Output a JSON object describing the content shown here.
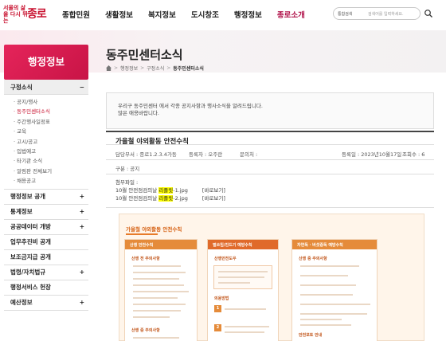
{
  "header": {
    "logo_small": "서울의 삶을 다시 뛰는",
    "logo_big": "종로",
    "nav": [
      "종합민원",
      "생활정보",
      "복지정보",
      "도시창조",
      "행정정보",
      "종로소개"
    ],
    "nav_active_index": 5,
    "search": {
      "scope": "통합검색",
      "placeholder": "검색어를 입력하세요."
    }
  },
  "banner": {
    "title": "동주민센터소식",
    "breadcrumb": [
      "행정정보",
      "구정소식",
      "동주민센터소식"
    ]
  },
  "sidebar": {
    "title": "행정정보",
    "open_group": {
      "label": "구정소식",
      "toggle": "−"
    },
    "sub_items": [
      {
        "label": "· 공지/행사",
        "active": false
      },
      {
        "label": "· 동주민센터소식",
        "active": true
      },
      {
        "label": "· 주간행사일정표",
        "active": false
      },
      {
        "label": "· 교육",
        "active": false
      },
      {
        "label": "· 고시/공고",
        "active": false
      },
      {
        "label": "· 입법예고",
        "active": false
      },
      {
        "label": "· 타기관 소식",
        "active": false
      },
      {
        "label": "· 알림판 전체보기",
        "active": false
      },
      {
        "label": "· 채용공고",
        "active": false
      }
    ],
    "groups": [
      {
        "label": "행정정보 공개",
        "toggle": "+"
      },
      {
        "label": "통계정보",
        "toggle": "+"
      },
      {
        "label": "공공데이터 개방",
        "toggle": "+"
      },
      {
        "label": "업무추진비 공개",
        "toggle": ""
      },
      {
        "label": "보조금지급 공개",
        "toggle": ""
      },
      {
        "label": "법령/자치법규",
        "toggle": "+"
      },
      {
        "label": "행정서비스 헌장",
        "toggle": ""
      },
      {
        "label": "예산정보",
        "toggle": "+"
      }
    ]
  },
  "intro": {
    "line1": "우리구 동주민센터 에서 각종 공지사항과 행사소식을 알려드립니다.",
    "line2": "많은 애용바랍니다."
  },
  "post": {
    "title": "가을철 야외활동 안전수칙",
    "dept": "담당부서 : 종로1.2.3.4가동",
    "writer": "등록자 : 오주란",
    "contact": "문의처 :",
    "date": "등록일 : 2023년10월17일",
    "views": "조회수 : 6",
    "category": "구분 : 공지",
    "attach_label": "첨부파일 :",
    "files": [
      {
        "prefix": "10월 안전점검의날 ",
        "highlight": "리플릿",
        "suffix": "-1.jpg",
        "preview": "[바로보기]"
      },
      {
        "prefix": "10월 안전점검의날 ",
        "highlight": "리플릿",
        "suffix": "-2.jpg",
        "preview": "[바로보기]"
      }
    ]
  },
  "poster": {
    "title": "가을철 야외활동 안전수칙",
    "columns": [
      {
        "header": "산행 안전수칙",
        "color": "#e58b3a"
      },
      {
        "header": "벌쏘임/진드기 예방수칙",
        "color": "#e06a2a"
      },
      {
        "header": "자연독 · 버섯중독 예방수칙",
        "color": "#e58b3a"
      }
    ],
    "col1_sub1": "산행 전 주의사항",
    "col1_sub2": "산행 중 주의사항",
    "col2_sub1": "산행안전도우",
    "col2_sub2": "의용방법",
    "col3_sub1": "산행 중 주의사항",
    "col3_sub2": "안전포토 안내"
  }
}
